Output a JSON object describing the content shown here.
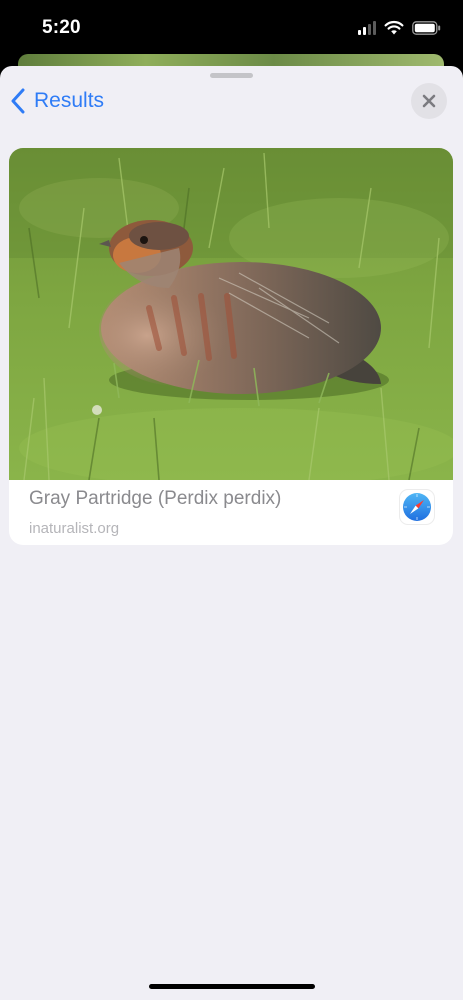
{
  "status_bar": {
    "time": "5:20"
  },
  "sheet": {
    "back_label": "Results",
    "back_icon": "chevron-left-icon",
    "close_icon": "xmark-icon"
  },
  "result": {
    "title": "Gray Partridge (Perdix perdix)",
    "source": "inaturalist.org",
    "image_subject": "gray partridge bird sitting in green grass",
    "browser_icon": "safari-compass-icon"
  },
  "colors": {
    "accent": "#2f7cf6",
    "sheet_background": "#f0eff5",
    "card_background": "#ffffff",
    "title_text": "#8a8a8e",
    "source_text": "#b5b5b9"
  }
}
